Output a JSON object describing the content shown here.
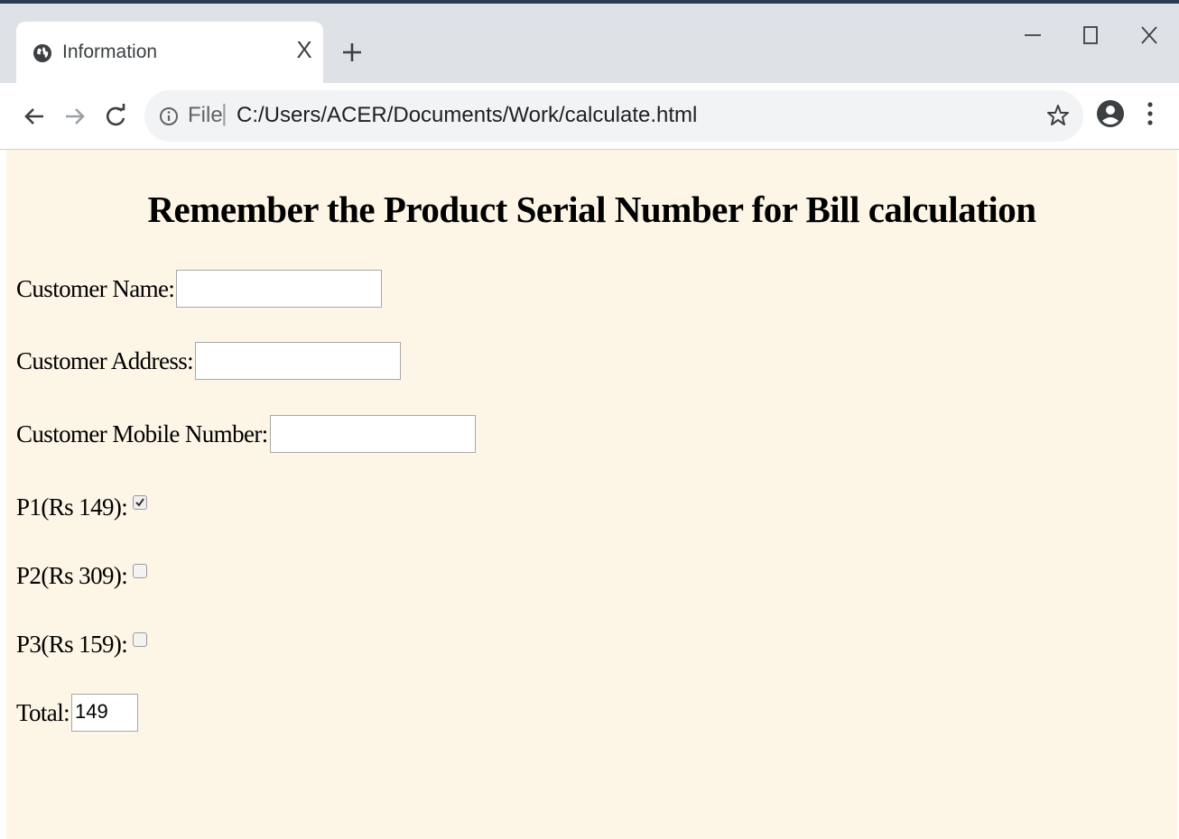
{
  "tab": {
    "title": "Information",
    "close_glyph": "X"
  },
  "address_bar": {
    "scheme_label": "File",
    "separator": "|",
    "path": "C:/Users/ACER/Documents/Work/calculate.html"
  },
  "page": {
    "heading": "Remember the Product Serial Number for Bill calculation",
    "fields": {
      "name_label": "Customer Name:",
      "name_value": "",
      "address_label": "Customer Address:",
      "address_value": "",
      "mobile_label": "Customer Mobile Number:",
      "mobile_value": ""
    },
    "products": [
      {
        "label": "P1(Rs 149):",
        "checked": true
      },
      {
        "label": "P2(Rs 309):",
        "checked": false
      },
      {
        "label": "P3(Rs 159):",
        "checked": false
      }
    ],
    "total_label": "Total:",
    "total_value": "149"
  },
  "icons": {
    "favicon": "globe-icon",
    "new_tab": "plus-icon",
    "back": "arrow-left-icon",
    "forward": "arrow-right-icon",
    "reload": "reload-icon",
    "info": "info-icon",
    "bookmark": "star-icon",
    "profile": "profile-icon",
    "menu": "more-vert-icon"
  },
  "colors": {
    "page_background": "#fdf5e6",
    "tabstrip": "#dee1e6",
    "omnibox": "#f1f3f4"
  }
}
